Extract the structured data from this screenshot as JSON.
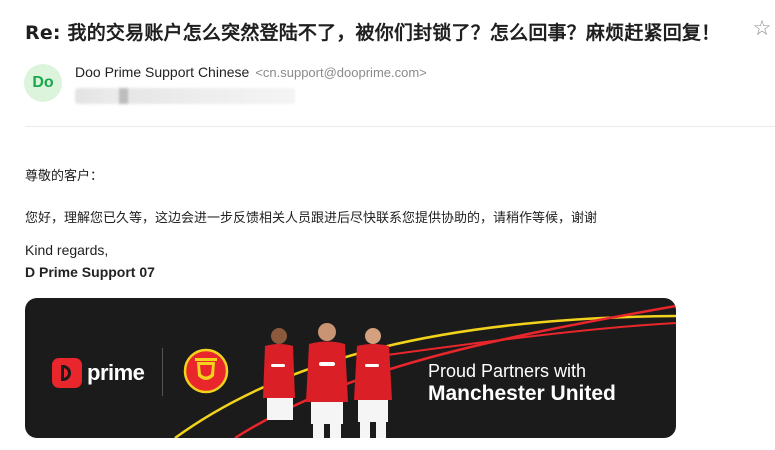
{
  "email": {
    "subject": "Re: 我的交易账户怎么突然登陆不了，被你们封锁了？怎么回事？麻烦赶紧回复！",
    "star_icon": "star-icon",
    "sender": {
      "avatar_initials": "Do",
      "name": "Doo Prime Support Chinese",
      "email": "<cn.support@dooprime.com>"
    },
    "body": {
      "greeting": "尊敬的客户：",
      "message": "您好，理解您已久等，这边会进一步反馈相关人员跟进后尽快联系您提供协助的，请稍作等候，谢谢",
      "regards": "Kind regards,",
      "signature": "D Prime Support 07"
    }
  },
  "banner": {
    "logo_text": "prime",
    "tagline_line1": "Proud Partners with",
    "tagline_line2": "Manchester United",
    "colors": {
      "background": "#1b1b1b",
      "brand_red": "#e8262b",
      "accent_yellow": "#f2d21b"
    }
  }
}
